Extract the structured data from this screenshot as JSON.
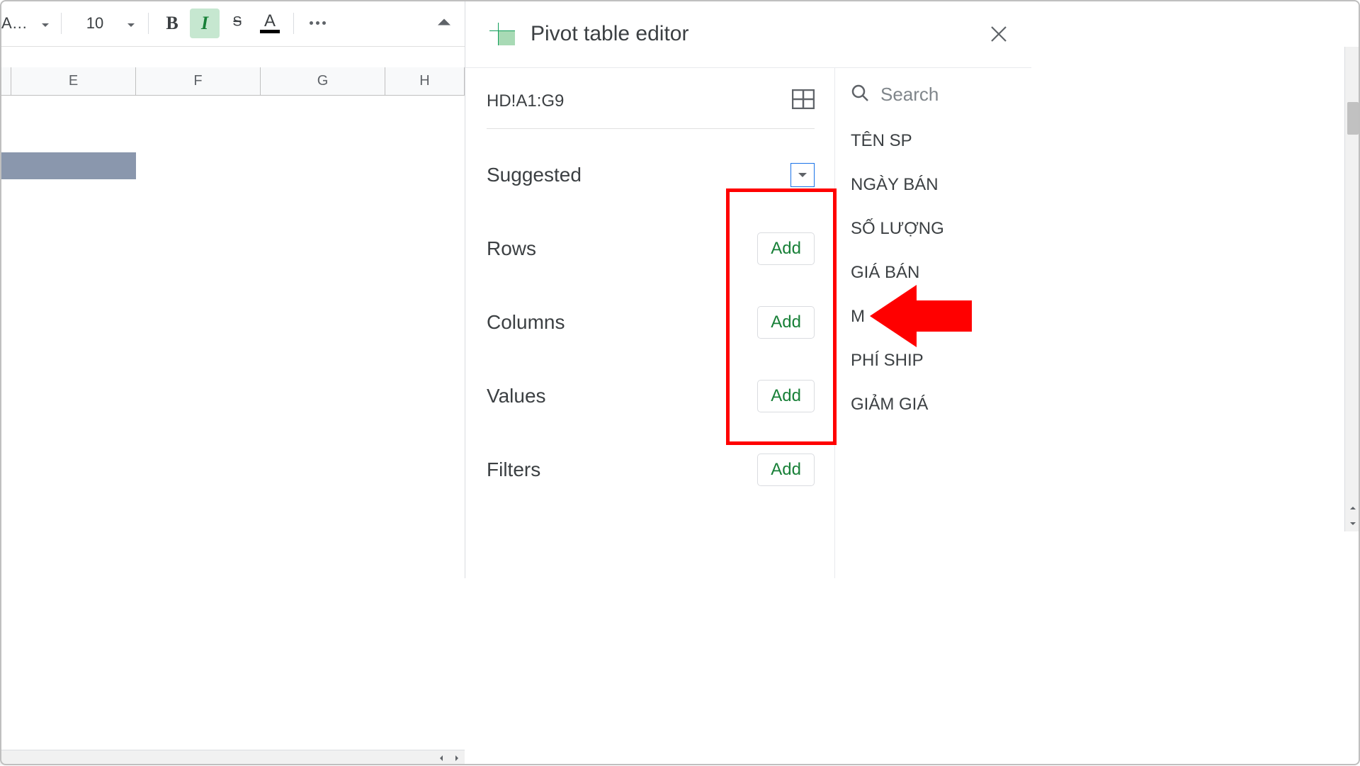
{
  "toolbar": {
    "font_name": "Ari…",
    "font_size": "10"
  },
  "columns": [
    "E",
    "F",
    "G",
    "H"
  ],
  "panel": {
    "title": "Pivot table editor",
    "range": "HD!A1:G9",
    "search_placeholder": "Search",
    "sections": {
      "suggested": "Suggested",
      "rows": "Rows",
      "columns": "Columns",
      "values": "Values",
      "filters": "Filters"
    },
    "add_label": "Add",
    "fields": [
      "TÊN SP",
      "NGÀY BÁN",
      "SỐ LƯỢNG",
      "GIÁ BÁN",
      "M",
      "PHÍ SHIP",
      "GIẢM GIÁ"
    ]
  }
}
